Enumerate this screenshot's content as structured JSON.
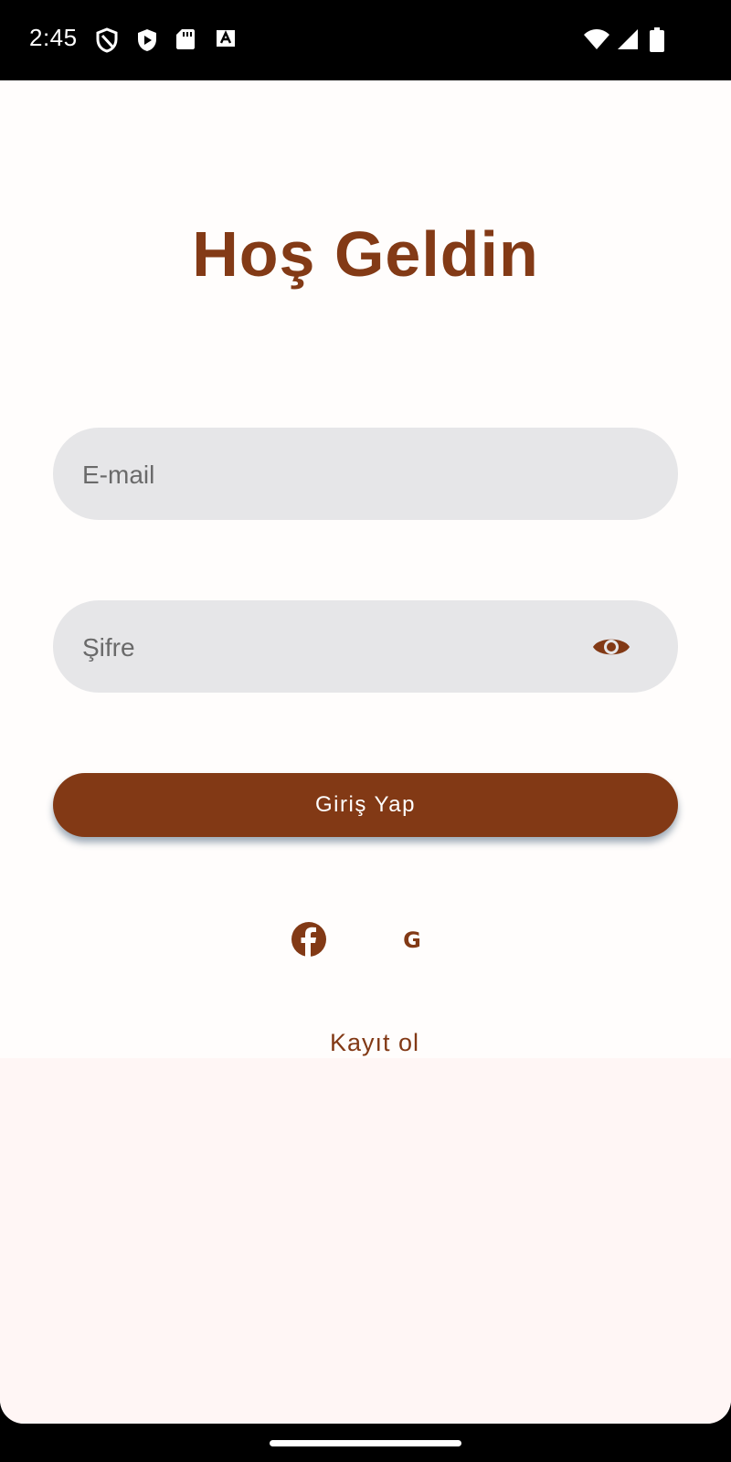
{
  "status_bar": {
    "time": "2:45",
    "left_icons": [
      "shield-icon",
      "play-shield-icon",
      "sd-card-icon",
      "font-a-icon"
    ],
    "right_icons": [
      "wifi-icon",
      "cellular-signal-icon",
      "battery-icon"
    ]
  },
  "login": {
    "title": "Hoş Geldin",
    "email_placeholder": "E-mail",
    "email_value": "",
    "password_placeholder": "Şifre",
    "password_value": "",
    "password_toggle_icon": "eye-icon",
    "login_button_label": "Giriş Yap",
    "social_icons": [
      "facebook-icon",
      "google-icon"
    ],
    "google_glyph": "G",
    "register_label": "Kayıt ol"
  },
  "colors": {
    "accent": "#823915",
    "field_background": "#e6e6e8",
    "screen_background": "#fffdfc",
    "lower_background": "#fff6f5"
  }
}
